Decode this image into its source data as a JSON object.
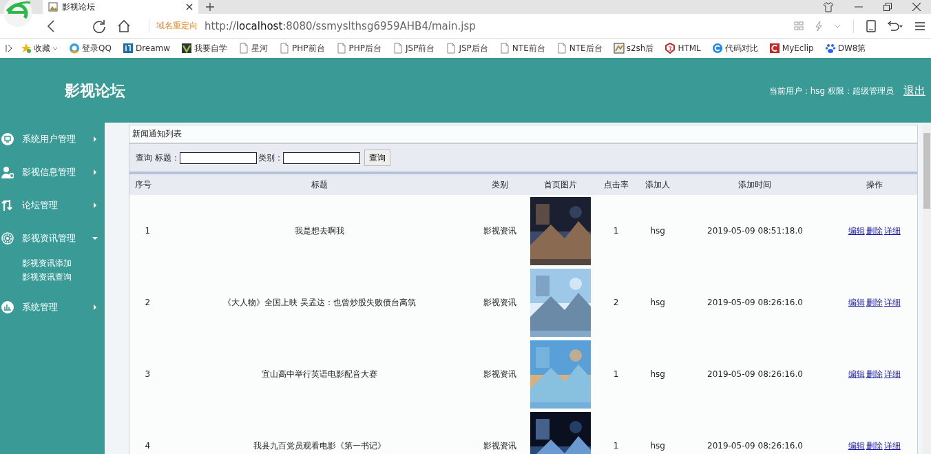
{
  "browser": {
    "tab": {
      "title": "影视论坛"
    },
    "redirect_label": "域名重定向",
    "url": {
      "host_prefix": "http://",
      "host": "localhost",
      "rest": ":8080/ssmyslthsg6959AHB4/main.jsp"
    },
    "bookmarks": [
      "收藏",
      "登录QQ",
      "Dreamw",
      "我要自学",
      "星河",
      "PHP前台",
      "PHP后台",
      "JSP前台",
      "JSP后台",
      "NTE前台",
      "NTE后台",
      "s2sh后",
      "HTML",
      "代码对比",
      "MyEclip",
      "DW8第"
    ]
  },
  "header": {
    "title": "影视论坛",
    "user_info": "当前用户：hsg  权限：超级管理员",
    "logout": "退出"
  },
  "sidebar": {
    "items": [
      {
        "label": "系统用户管理",
        "expanded": false
      },
      {
        "label": "影视信息管理",
        "expanded": false
      },
      {
        "label": "论坛管理",
        "expanded": false
      },
      {
        "label": "影视资讯管理",
        "expanded": true,
        "children": [
          {
            "label": "影视资讯添加"
          },
          {
            "label": "影视资讯查询"
          }
        ]
      },
      {
        "label": "系统管理",
        "expanded": false
      }
    ]
  },
  "panel": {
    "title": "新闻通知列表",
    "search": {
      "prefix": "查询",
      "title_label": "标题：",
      "category_label": "类别：",
      "button": "查询"
    },
    "table": {
      "columns": [
        "序号",
        "标题",
        "类别",
        "首页图片",
        "点击率",
        "添加人",
        "添加时间",
        "操作"
      ],
      "rows": [
        {
          "index": "1",
          "title": "我是想去啊我",
          "category": "影视资讯",
          "image": {
            "kind": "picture"
          },
          "clicks": "1",
          "added_by": "hsg",
          "added_at": "2019-05-09 08:51:18.0",
          "actions": [
            "编辑",
            "删除",
            "详细"
          ]
        },
        {
          "index": "2",
          "title": "《大人物》全国上映 吴孟达：也曾炒股失败债台高筑",
          "category": "影视资讯",
          "image": {
            "kind": "picture"
          },
          "clicks": "2",
          "added_by": "hsg",
          "added_at": "2019-05-09 08:26:16.0",
          "actions": [
            "编辑",
            "删除",
            "详细"
          ]
        },
        {
          "index": "3",
          "title": "宜山高中举行英语电影配音大赛",
          "category": "影视资讯",
          "image": {
            "kind": "picture"
          },
          "clicks": "1",
          "added_by": "hsg",
          "added_at": "2019-05-09 08:26:16.0",
          "actions": [
            "编辑",
            "删除",
            "详细"
          ]
        },
        {
          "index": "4",
          "title": "我县九百党员观看电影《第一书记》",
          "category": "影视资讯",
          "image": {
            "kind": "picture"
          },
          "clicks": "1",
          "added_by": "hsg",
          "added_at": "2019-05-09 08:26:16.0",
          "actions": [
            "编辑",
            "删除",
            "详细"
          ]
        }
      ]
    }
  }
}
